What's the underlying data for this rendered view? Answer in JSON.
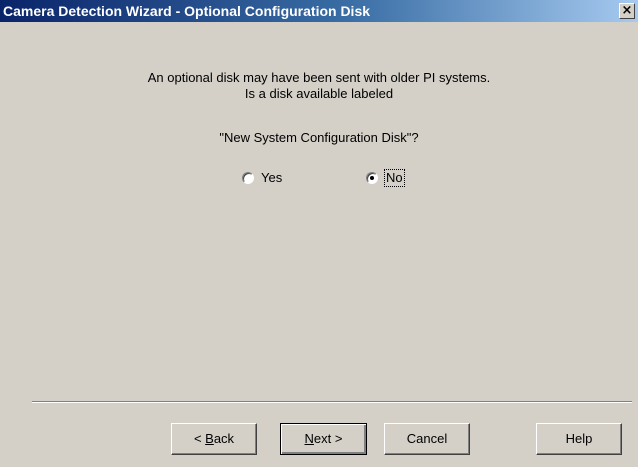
{
  "window": {
    "title": "Camera Detection Wizard - Optional Configuration Disk",
    "close_glyph": "×"
  },
  "message": {
    "line1": "An optional disk may have been sent with older PI systems.",
    "line2": "Is a disk available labeled",
    "line3": "\"New System Configuration Disk\"?"
  },
  "options": {
    "yes_label": "Yes",
    "no_label": "No",
    "selected": "No"
  },
  "buttons": {
    "back_prefix": "< ",
    "back_mnemonic": "B",
    "back_rest": "ack",
    "next_mnemonic": "N",
    "next_rest": "ext >",
    "cancel_label": "Cancel",
    "help_label": "Help"
  },
  "colors": {
    "title_start": "#0a246a",
    "title_end": "#a6caf0",
    "face": "#d4d0c8"
  }
}
